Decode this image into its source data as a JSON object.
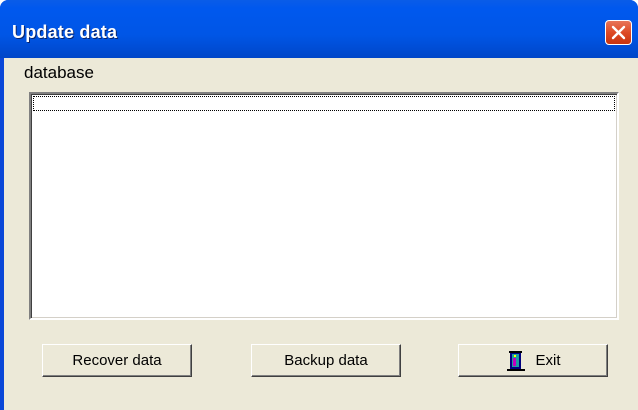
{
  "window": {
    "title": "Update data"
  },
  "group": {
    "label": "database"
  },
  "list": {
    "items": []
  },
  "buttons": {
    "recover_label": "Recover data",
    "backup_label": "Backup data",
    "exit_label": "Exit"
  },
  "icons": {
    "close": "close-icon",
    "exit": "door-exit-icon"
  },
  "colors": {
    "titlebar": "#0054e3",
    "close_button": "#dd4a25",
    "dialog_background": "#ece9d8"
  }
}
